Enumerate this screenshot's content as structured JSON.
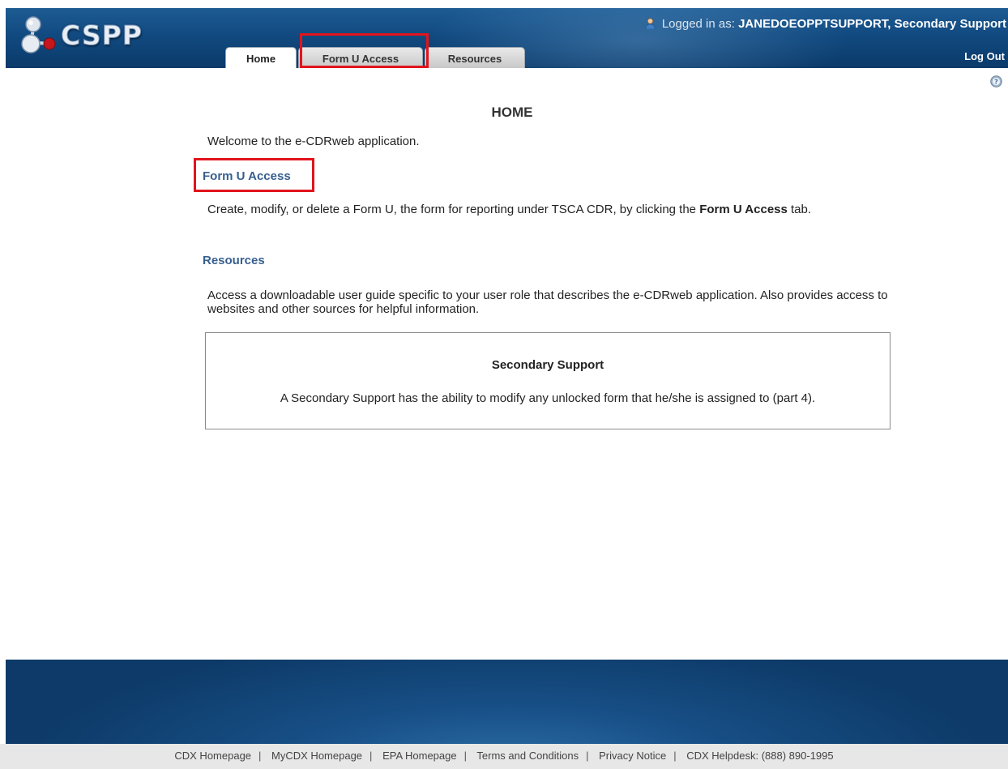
{
  "header": {
    "logo_text": "CSPP",
    "logged_in_prefix": "Logged in as:",
    "user_name": "JANEDOEOPPTSUPPORT",
    "user_role": "Secondary Support",
    "logout_label": "Log Out"
  },
  "tabs": [
    {
      "label": "Home",
      "active": true
    },
    {
      "label": "Form U Access",
      "active": false
    },
    {
      "label": "Resources",
      "active": false
    }
  ],
  "main": {
    "title": "HOME",
    "welcome": "Welcome to the e-CDRweb application.",
    "form_u_heading": "Form U Access",
    "form_u_text_before": "Create, modify, or delete a Form U, the form for reporting under TSCA CDR, by clicking the ",
    "form_u_text_bold": "Form U Access",
    "form_u_text_after": " tab.",
    "resources_heading": "Resources",
    "resources_text": "Access a downloadable user guide specific to your user role that describes the e-CDRweb application. Also provides access to websites and other sources for helpful information.",
    "role_box": {
      "title": "Secondary Support",
      "description": "A Secondary Support has the ability to modify any unlocked form that he/she is assigned to (part 4)."
    }
  },
  "footer": {
    "links": [
      "CDX Homepage",
      "MyCDX Homepage",
      "EPA Homepage",
      "Terms and Conditions",
      "Privacy Notice"
    ],
    "helpdesk": "CDX Helpdesk: (888) 890-1995"
  },
  "colors": {
    "header_blue": "#114a80",
    "heading_blue": "#365f8f",
    "highlight_red": "#e1141c"
  },
  "icons": [
    "cspp-molecule-logo-icon",
    "user-icon",
    "help-icon"
  ]
}
